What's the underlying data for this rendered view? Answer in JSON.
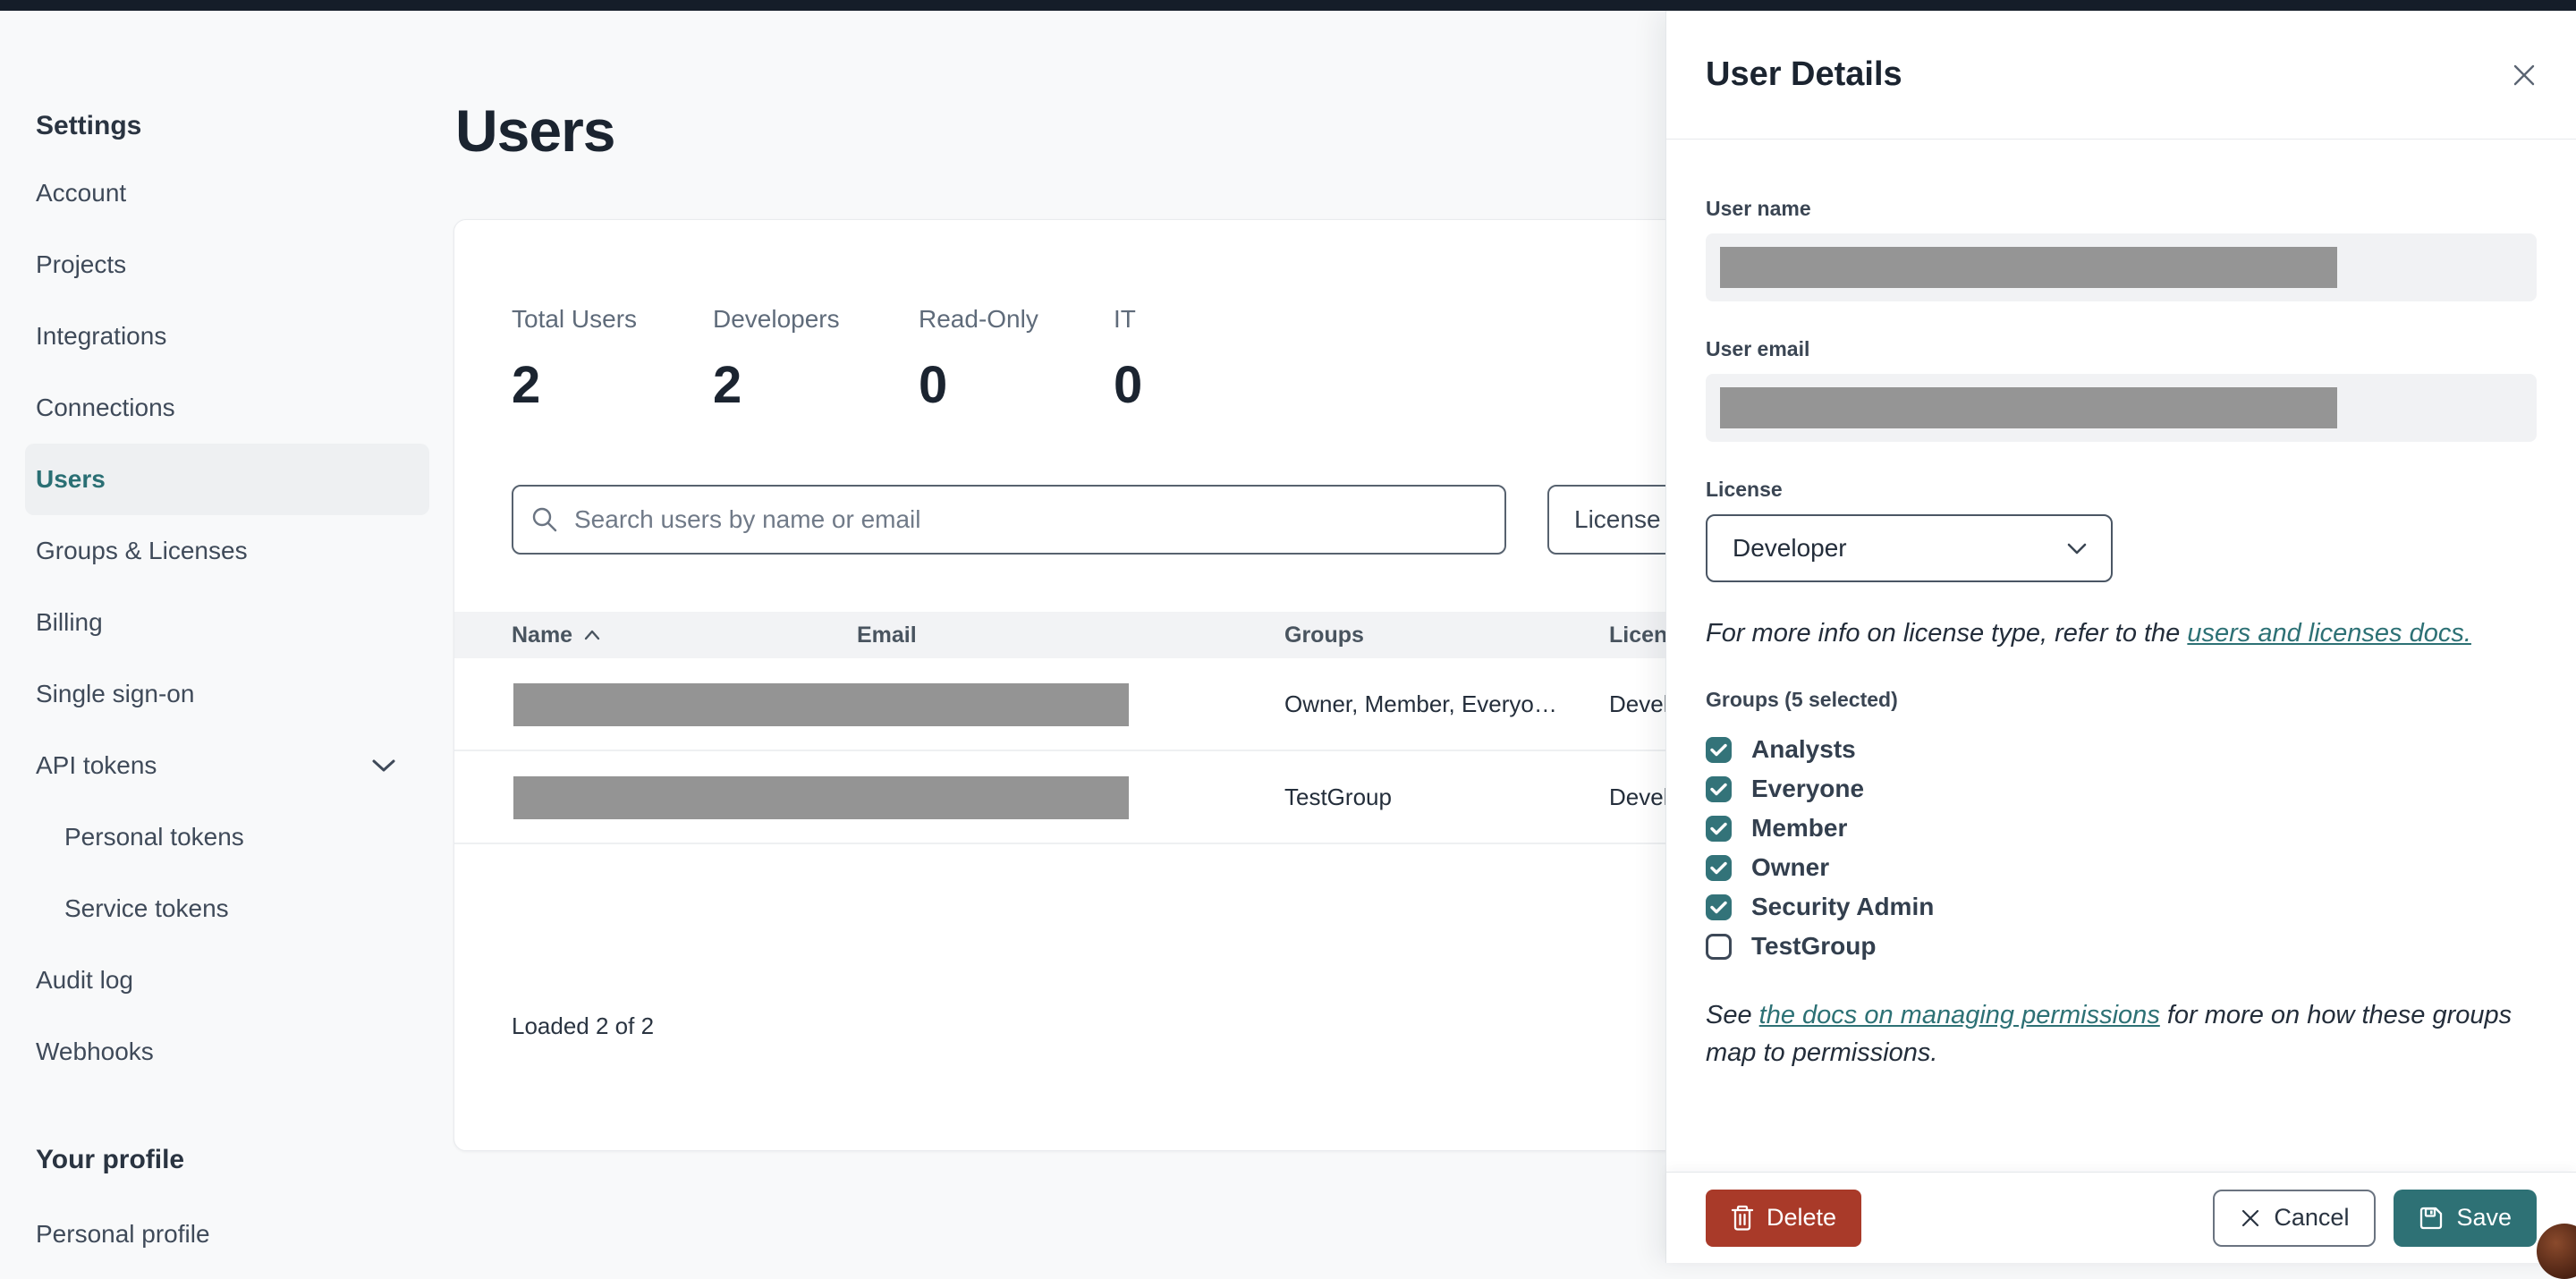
{
  "sidebar": {
    "section_title": "Settings",
    "items": [
      {
        "label": "Account"
      },
      {
        "label": "Projects"
      },
      {
        "label": "Integrations"
      },
      {
        "label": "Connections"
      },
      {
        "label": "Users",
        "selected": true
      },
      {
        "label": "Groups & Licenses"
      },
      {
        "label": "Billing"
      },
      {
        "label": "Single sign-on"
      },
      {
        "label": "API tokens",
        "has_chevron": true
      },
      {
        "label": "Personal tokens",
        "sub": true
      },
      {
        "label": "Service tokens",
        "sub": true
      },
      {
        "label": "Audit log"
      },
      {
        "label": "Webhooks"
      }
    ],
    "profile_section_title": "Your profile",
    "profile_item": "Personal profile"
  },
  "main": {
    "page_title": "Users",
    "stats": [
      {
        "label": "Total Users",
        "value": "2"
      },
      {
        "label": "Developers",
        "value": "2"
      },
      {
        "label": "Read-Only",
        "value": "0"
      },
      {
        "label": "IT",
        "value": "0"
      }
    ],
    "search": {
      "placeholder": "Search users by name or email"
    },
    "license_filter_label": "License",
    "table": {
      "columns": [
        "Name",
        "Email",
        "Groups",
        "License"
      ],
      "sort_column": "Name",
      "sort_direction": "ascending",
      "rows": [
        {
          "groups": "Owner, Member, Everyo…",
          "license": "Developer"
        },
        {
          "groups": "TestGroup",
          "license": "Developer"
        }
      ]
    },
    "loaded_text": "Loaded 2 of 2"
  },
  "panel": {
    "title": "User Details",
    "user_name_label": "User name",
    "user_email_label": "User email",
    "license_label": "License",
    "license_value": "Developer",
    "license_note": {
      "prefix": "For more info on license type, refer to the ",
      "link": "users and licenses docs."
    },
    "groups_label": "Groups (5 selected)",
    "groups": [
      {
        "label": "Analysts",
        "checked": true
      },
      {
        "label": "Everyone",
        "checked": true
      },
      {
        "label": "Member",
        "checked": true
      },
      {
        "label": "Owner",
        "checked": true
      },
      {
        "label": "Security Admin",
        "checked": true
      },
      {
        "label": "TestGroup",
        "checked": false
      }
    ],
    "permissions_note": {
      "prefix": "See ",
      "link": "the docs on managing permissions",
      "suffix": " for more on how these groups map to permissions."
    },
    "buttons": {
      "delete": "Delete",
      "cancel": "Cancel",
      "save": "Save"
    }
  },
  "colors": {
    "accent_teal": "#337379",
    "danger_red": "#a93a29",
    "topbar_navy": "#151d29",
    "redaction_gray": "#949494"
  }
}
